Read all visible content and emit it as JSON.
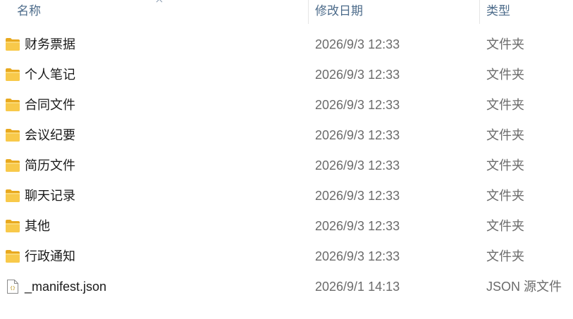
{
  "header": {
    "name_label": "名称",
    "date_label": "修改日期",
    "type_label": "类型"
  },
  "files": [
    {
      "icon": "folder-icon",
      "name": "财务票据",
      "date": "2026/9/3 12:33",
      "type": "文件夹"
    },
    {
      "icon": "folder-icon",
      "name": "个人笔记",
      "date": "2026/9/3 12:33",
      "type": "文件夹"
    },
    {
      "icon": "folder-icon",
      "name": "合同文件",
      "date": "2026/9/3 12:33",
      "type": "文件夹"
    },
    {
      "icon": "folder-icon",
      "name": "会议纪要",
      "date": "2026/9/3 12:33",
      "type": "文件夹"
    },
    {
      "icon": "folder-icon",
      "name": "简历文件",
      "date": "2026/9/3 12:33",
      "type": "文件夹"
    },
    {
      "icon": "folder-icon",
      "name": "聊天记录",
      "date": "2026/9/3 12:33",
      "type": "文件夹"
    },
    {
      "icon": "folder-icon",
      "name": "其他",
      "date": "2026/9/3 12:33",
      "type": "文件夹"
    },
    {
      "icon": "folder-icon",
      "name": "行政通知",
      "date": "2026/9/3 12:33",
      "type": "文件夹"
    },
    {
      "icon": "json-file-icon",
      "name": "_manifest.json",
      "date": "2026/9/1 14:13",
      "type": "JSON 源文件"
    }
  ],
  "colors": {
    "folder_front": "#F8C94A",
    "folder_back": "#E8A91F",
    "header_text": "#4C6B8A",
    "secondary_text": "#6B6B6B"
  }
}
